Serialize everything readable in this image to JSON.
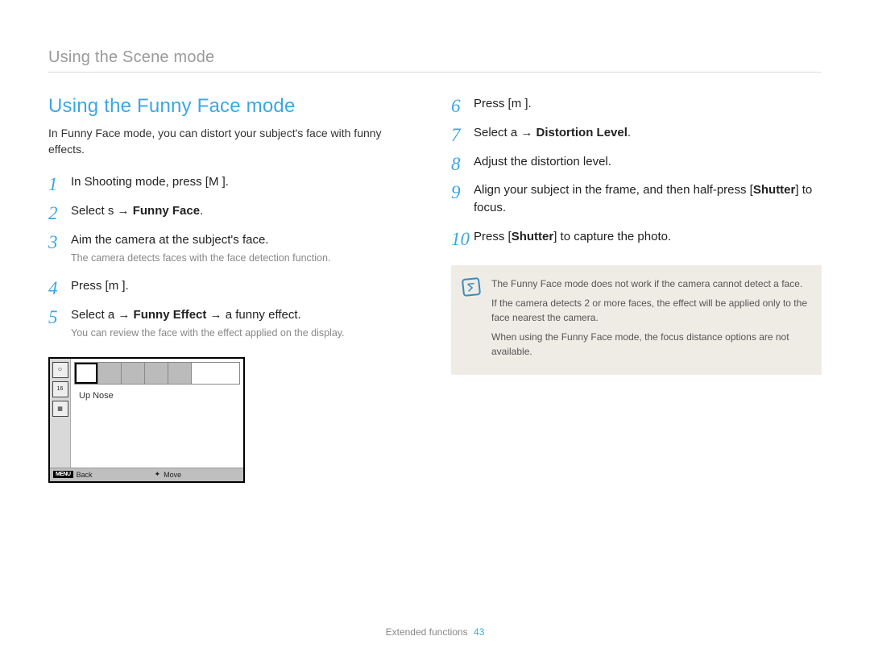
{
  "breadcrumb": "Using the Scene mode",
  "section_title": "Using the Funny Face mode",
  "intro": "In Funny Face mode, you can distort your subject's face with funny effects.",
  "left_steps": [
    {
      "num": "1",
      "text_parts": [
        "In Shooting mode, press [",
        "M",
        "    ]."
      ],
      "bold_at": null,
      "sub": null
    },
    {
      "num": "2",
      "text_parts": [
        "Select ",
        "s",
        "    → ",
        "Funny Face",
        "."
      ],
      "bold_at": [
        3
      ],
      "sub": null
    },
    {
      "num": "3",
      "text_parts": [
        "Aim the camera at the subject's face."
      ],
      "sub": "The camera detects faces with the face detection function."
    },
    {
      "num": "4",
      "text_parts": [
        "Press [",
        "m",
        "    ]."
      ],
      "sub": null
    },
    {
      "num": "5",
      "text_parts": [
        "Select ",
        "a",
        "    → ",
        "Funny Effect",
        " → a funny effect."
      ],
      "bold_at": [
        3
      ],
      "sub": "You can review the face with the effect applied on the display."
    }
  ],
  "right_steps": [
    {
      "num": "6",
      "text_parts": [
        "Press [",
        "m",
        "    ]."
      ]
    },
    {
      "num": "7",
      "text_parts": [
        "Select ",
        "a",
        "    → ",
        "Distortion Level",
        "."
      ],
      "bold_at": [
        3
      ]
    },
    {
      "num": "8",
      "text_parts": [
        "Adjust the distortion level."
      ]
    },
    {
      "num": "9",
      "text_parts": [
        "Align your subject in the frame, and then half-press [",
        "Shutter",
        "] to focus."
      ],
      "bold_at": [
        1
      ]
    },
    {
      "num": "10",
      "text_parts": [
        "Press [",
        "Shutter",
        "] to capture the photo."
      ],
      "bold_at": [
        1
      ]
    }
  ],
  "screen": {
    "label": "Up Nose",
    "back": "Back",
    "move": "Move",
    "menu": "MENU",
    "side_icons": [
      "face",
      "16m",
      "grid"
    ]
  },
  "notes": [
    "The Funny Face mode does not work if the camera cannot detect a face.",
    "If the camera detects 2 or more faces, the effect will be applied only to the face nearest the camera.",
    "When using the Funny Face mode, the focus distance options are not available."
  ],
  "footer": {
    "section": "Extended functions",
    "page": "43"
  }
}
